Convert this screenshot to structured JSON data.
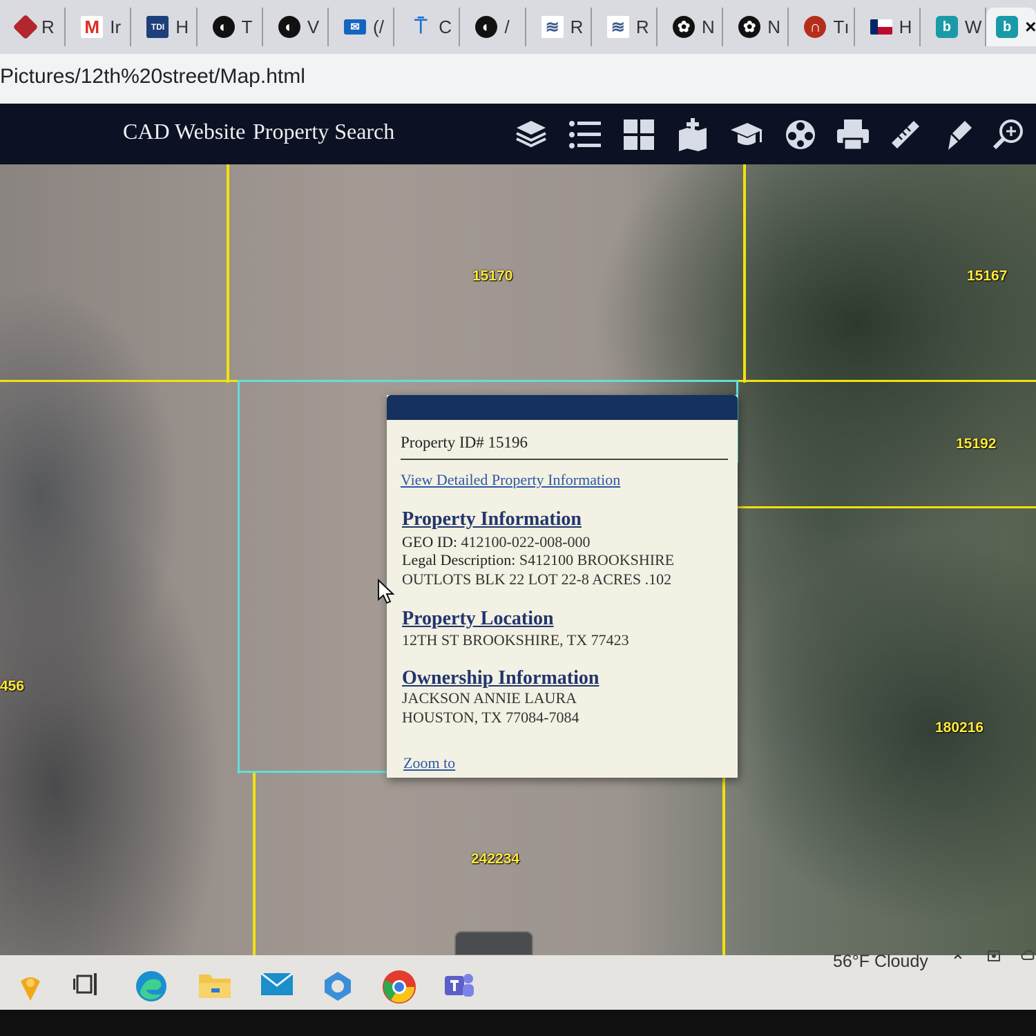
{
  "browser": {
    "tabs": [
      {
        "label": "R",
        "icon": "ruby-red-icon",
        "color": "#b3262d"
      },
      {
        "label": "Ir",
        "icon": "gmail-icon",
        "color": "#d93025"
      },
      {
        "label": "H",
        "icon": "tdi-icon",
        "color": "#1d3f7a"
      },
      {
        "label": "T",
        "icon": "globe-icon",
        "color": "#111111"
      },
      {
        "label": "V",
        "icon": "globe-icon",
        "color": "#111111"
      },
      {
        "label": "(/",
        "icon": "mail-icon",
        "color": "#1565c0"
      },
      {
        "label": "C",
        "icon": "antenna-icon",
        "color": "#1e6fd0"
      },
      {
        "label": "/",
        "icon": "globe-icon",
        "color": "#111111"
      },
      {
        "label": "R",
        "icon": "waves-icon",
        "color": "#3a5b8c"
      },
      {
        "label": "R",
        "icon": "waves-icon",
        "color": "#3a5b8c"
      },
      {
        "label": "N",
        "icon": "openai-icon",
        "color": "#111111"
      },
      {
        "label": "N",
        "icon": "openai-icon",
        "color": "#111111"
      },
      {
        "label": "Tı",
        "icon": "swoosh-icon",
        "color": "#b52e1c"
      },
      {
        "label": "H",
        "icon": "texas-flag-icon",
        "color": "#bf0a30"
      },
      {
        "label": "W",
        "icon": "bing-icon",
        "color": "#1a9aa8"
      }
    ],
    "active_tab": {
      "icon": "bing-icon",
      "close": "×"
    },
    "url": "Pictures/12th%20street/Map.html"
  },
  "toolbar": {
    "nav_links": [
      "CAD Website",
      "Property Search"
    ],
    "tools": [
      "layers-icon",
      "legend-list-icon",
      "basemap-grid-icon",
      "add-data-icon",
      "education-cap-icon",
      "film-reel-icon",
      "print-icon",
      "ruler-icon",
      "draw-icon",
      "zoom-search-icon"
    ]
  },
  "map": {
    "parcel_labels": [
      "15170",
      "15167",
      "15192",
      "180216",
      "242234",
      "456"
    ],
    "colors": {
      "parcel_line": "#f2e20a",
      "selected_line": "#5ee0d8",
      "label": "#ffe93a"
    }
  },
  "popup": {
    "property_id": "Property ID# 15196",
    "view_link": "View Detailed Property Information",
    "property_info": {
      "title": "Property  Information",
      "geo_id_label": "GEO ID:",
      "geo_id": " 412100-022-008-000",
      "legal_label": "Legal Description:",
      "legal_line1": " S412100 BROOKSHIRE",
      "legal_line2": "OUTLOTS BLK 22 LOT 22-8 ACRES .102"
    },
    "location": {
      "title": "Property  Location",
      "address": "12TH ST BROOKSHIRE, TX 77423"
    },
    "ownership": {
      "title": "Ownership  Information",
      "owner": "JACKSON ANNIE LAURA",
      "city": "HOUSTON, TX  77084-7084"
    },
    "zoom_link": "Zoom to",
    "header_color": "#14315f"
  },
  "taskbar": {
    "apps": [
      "widgets-icon",
      "task-view-icon",
      "edge-icon",
      "file-explorer-icon",
      "mail-icon",
      "copilot-icon",
      "chrome-icon",
      "teams-icon"
    ],
    "weather": "56°F  Cloudy"
  }
}
